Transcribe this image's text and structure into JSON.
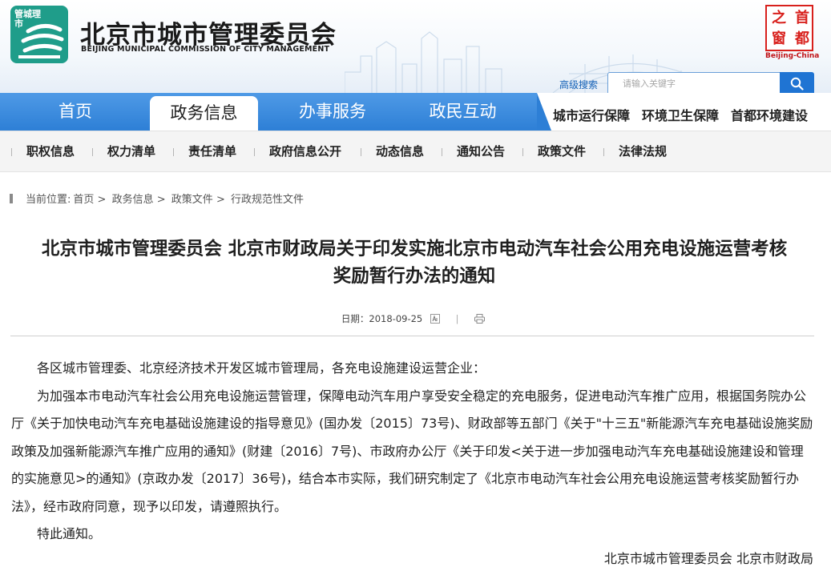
{
  "header": {
    "logo_text": "管城理市",
    "org_name": "北京市城市管理委员会",
    "org_name_en": "BEIJING MUNICIPAL COMMISSION OF CITY MANAGEMENT",
    "seal_glyphs": [
      "首",
      "都",
      "之",
      "窗"
    ],
    "seal_caption": "Beijing-China",
    "advanced_search": "高级搜索",
    "search_placeholder": "请输入关键字"
  },
  "nav": {
    "items": [
      "首页",
      "政务信息",
      "办事服务",
      "政民互动"
    ],
    "active": "政务信息",
    "right_links": [
      "城市运行保障",
      "环境卫生保障",
      "首都环境建设"
    ]
  },
  "subnav": {
    "items": [
      "职权信息",
      "权力清单",
      "责任清单",
      "政府信息公开",
      "动态信息",
      "通知公告",
      "政策文件",
      "法律法规"
    ]
  },
  "breadcrumb": {
    "prefix": "当前位置:",
    "items": [
      "首页",
      "政务信息",
      "政策文件",
      "行政规范性文件"
    ],
    "separator": ">"
  },
  "article": {
    "title_line1": "北京市城市管理委员会 北京市财政局关于印发实施北京市电动汽车社会公用充电设施运营考核",
    "title_line2": "奖励暂行办法的通知",
    "date_label": "日期：",
    "date": "2018-09-25",
    "salutation": "各区城市管理委、北京经济技术开发区城市管理局，各充电设施建设运营企业：",
    "paragraph": "为加强本市电动汽车社会公用充电设施运营管理，保障电动汽车用户享受安全稳定的充电服务，促进电动汽车推广应用，根据国务院办公厅《关于加快电动汽车充电基础设施建设的指导意见》(国办发〔2015〕73号)、财政部等五部门《关于\"十三五\"新能源汽车充电基础设施奖励政策及加强新能源汽车推广应用的通知》(财建〔2016〕7号)、市政府办公厅《关于印发<关于进一步加强电动汽车充电基础设施建设和管理的实施意见>的通知》(京政办发〔2017〕36号)，结合本市实际，我们研究制定了《北京市电动汽车社会公用充电设施运营考核奖励暂行办法》，经市政府同意，现予以印发，请遵照执行。",
    "closing": "特此通知。",
    "signature": "北京市城市管理委员会 北京市财政局"
  },
  "colors": {
    "nav_blue": "#2d7fd6",
    "logo_green": "#1f9d8a",
    "seal_red": "#d8201c",
    "link_blue": "#1763b8"
  }
}
